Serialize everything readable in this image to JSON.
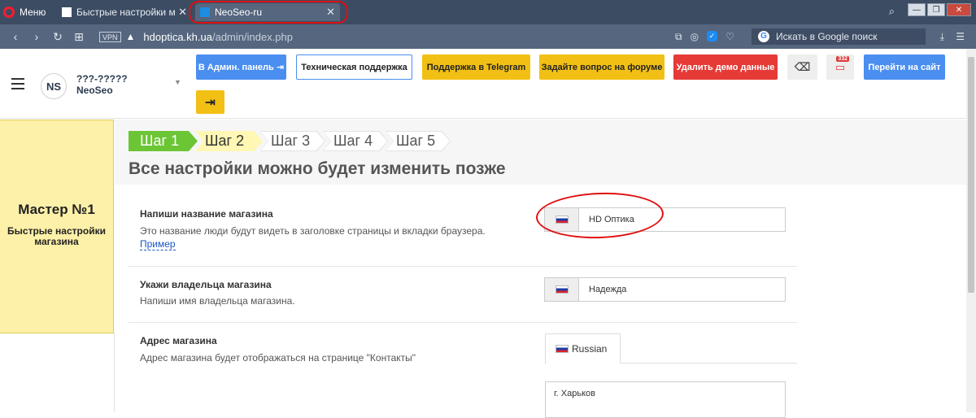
{
  "browser": {
    "menu_label": "Меню",
    "tabs": [
      {
        "label": "Быстрые настройки магаз"
      },
      {
        "label": "NeoSeo-ru"
      }
    ],
    "url_host": "hdoptica.kh.ua",
    "url_path": "/admin/index.php",
    "vpn_label": "VPN",
    "search_placeholder": "Искать в Google поиск"
  },
  "header": {
    "store_line1": "???-?????",
    "store_line2": "NeoSeo",
    "logo_text": "NS",
    "buttons": {
      "admin": "В Админ. панель",
      "support": "Техническая поддержка",
      "telegram": "Поддержка в Telegram",
      "forum": "Задайте вопрос на форуме",
      "delete_demo": "Удалить демо данные",
      "monitor_badge": "332",
      "site": "Перейти на сайт"
    },
    "colors": {
      "blue": "#4a8ef0",
      "yellow": "#f2c014",
      "red": "#e63a37"
    }
  },
  "wizard": {
    "title": "Мастер №1",
    "subtitle": "Быстрые настройки магазина",
    "steps": [
      "Шаг 1",
      "Шаг 2",
      "Шаг 3",
      "Шаг 4",
      "Шаг 5"
    ],
    "active_step": 1,
    "heading": "Все настройки можно будет изменить позже"
  },
  "form": {
    "store_name": {
      "label": "Напиши название магазина",
      "desc": "Это название люди будут видеть в заголовке страницы и вкладки браузера.",
      "link": "Пример",
      "value": "HD Оптика"
    },
    "owner": {
      "label": "Укажи владельца магазина",
      "desc": "Напиши имя владельца магазина.",
      "value": "Надежда"
    },
    "address": {
      "label": "Адрес магазина",
      "desc": "Адрес магазина будет отображаться на странице \"Контакты\"",
      "lang_tab": "Russian",
      "value": "г. Харьков"
    }
  }
}
